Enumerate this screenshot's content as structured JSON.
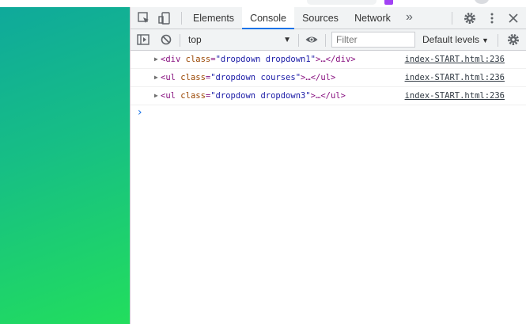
{
  "devtools": {
    "tabs": [
      {
        "label": "Elements",
        "active": false
      },
      {
        "label": "Console",
        "active": true
      },
      {
        "label": "Sources",
        "active": false
      },
      {
        "label": "Network",
        "active": false
      }
    ],
    "more_tabs_glyph": "»",
    "icons": {
      "inspect": "inspect-element-icon",
      "device": "device-toolbar-icon",
      "settings": "gear-icon",
      "menu": "kebab-menu-icon",
      "close": "close-icon",
      "sidebar": "console-sidebar-icon",
      "clear": "clear-console-icon",
      "eye": "live-expression-eye-icon"
    },
    "accent_color": "#1a73e8"
  },
  "toolbar": {
    "context": "top",
    "context_caret": "▼",
    "filter_placeholder": "Filter",
    "levels_label": "Default levels",
    "levels_caret": "▼"
  },
  "console": {
    "entries": [
      {
        "tag_open": "<div",
        "attr_name": "class",
        "attr_value": "\"dropdown dropdown1\"",
        "ellipsis": ">…",
        "tag_close": "</div>",
        "source": "index-START.html:236"
      },
      {
        "tag_open": "<ul",
        "attr_name": "class",
        "attr_value": "\"dropdown courses\"",
        "ellipsis": ">…",
        "tag_close": "</ul>",
        "source": "index-START.html:236"
      },
      {
        "tag_open": "<ul",
        "attr_name": "class",
        "attr_value": "\"dropdown dropdown3\"",
        "ellipsis": ">…",
        "tag_close": "</ul>",
        "source": "index-START.html:236"
      }
    ],
    "prompt_glyph": "›"
  },
  "page": {
    "gradient_start": "#0fa99b",
    "gradient_end": "#22de5d"
  }
}
